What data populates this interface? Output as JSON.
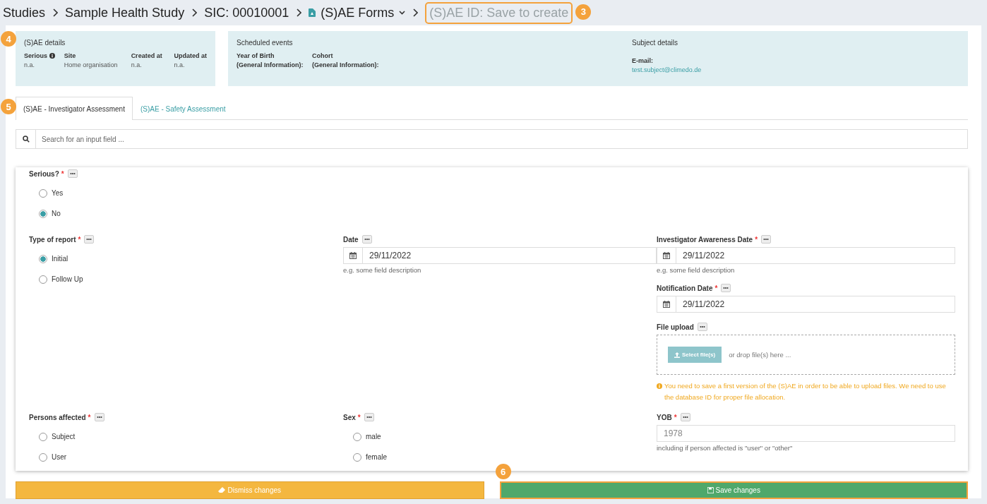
{
  "breadcrumb": [
    {
      "label": "Studies",
      "kind": "link"
    },
    {
      "label": "Sample Health Study",
      "kind": "link"
    },
    {
      "label": "SIC: 00010001",
      "kind": "link"
    },
    {
      "label": "(S)AE Forms",
      "kind": "menu"
    },
    {
      "label": "(S)AE ID: Save to create",
      "kind": "current",
      "badge": "3",
      "highlighted": true
    }
  ],
  "sae_details": {
    "title": "(S)AE details",
    "badge": "4",
    "fields": [
      {
        "label": "Serious",
        "value": "n.a.",
        "info": true
      },
      {
        "label": "Site",
        "value": "Home organisation",
        "info": false
      },
      {
        "label": "Created at",
        "value": "n.a.",
        "info": false
      },
      {
        "label": "Updated at",
        "value": "n.a.",
        "info": false
      }
    ]
  },
  "scheduled_events": {
    "title": "Scheduled events",
    "fields": [
      {
        "label": "Year of Birth",
        "sublabel": "(General Information):"
      },
      {
        "label": "Cohort",
        "sublabel": "(General Information):"
      }
    ]
  },
  "subject_details": {
    "title": "Subject details",
    "fields": [
      {
        "label": "E-mail:",
        "value": "test.subject@climedo.de"
      }
    ]
  },
  "tabs": [
    {
      "label": "(S)AE - Investigator Assessment",
      "selected": true,
      "badge": "5"
    },
    {
      "label": "(S)AE - Safety Assessment",
      "selected": false
    }
  ],
  "search": {
    "placeholder": "Search for an input field ..."
  },
  "form": {
    "required_mark": "*",
    "rows": [
      [
        [
          {
            "kind": "radio",
            "label": "Serious?",
            "required": true,
            "options": [
              {
                "label": "Yes",
                "selected": false
              },
              {
                "label": "No",
                "selected": true
              }
            ]
          }
        ]
      ],
      [
        [
          {
            "kind": "radio",
            "label": "Type of report",
            "required": true,
            "options": [
              {
                "label": "Initial",
                "selected": true
              },
              {
                "label": "Follow Up",
                "selected": false
              }
            ]
          }
        ],
        [
          {
            "kind": "date",
            "label": "Date",
            "required": false,
            "value": "29/11/2022",
            "description": "e.g. some field description"
          }
        ],
        [
          {
            "kind": "date",
            "label": "Investigator Awareness Date",
            "required": true,
            "value": "29/11/2022",
            "description": "e.g. some field description"
          },
          {
            "kind": "date",
            "label": "Notification Date",
            "required": true,
            "value": "29/11/2022"
          },
          {
            "kind": "file",
            "label": "File upload",
            "required": false,
            "button": "Select file(s)",
            "hint": "or drop file(s) here ...",
            "warning": "You need to save a first version of the (S)AE in order to be able to upload files. We need to use the database ID for proper file allocation."
          }
        ]
      ],
      [
        [
          {
            "kind": "radio",
            "label": "Persons affected",
            "required": true,
            "options": [
              {
                "label": "Subject",
                "selected": false
              },
              {
                "label": "User",
                "selected": false
              }
            ]
          }
        ],
        [
          {
            "kind": "radio",
            "label": "Sex",
            "required": true,
            "options": [
              {
                "label": "male",
                "selected": false
              },
              {
                "label": "female",
                "selected": false
              }
            ]
          }
        ],
        [
          {
            "kind": "number",
            "label": "YOB",
            "required": true,
            "placeholder": "1978",
            "description": "including if person affected is \"user\" or \"other\""
          }
        ]
      ]
    ]
  },
  "actions": [
    {
      "label": "Dismiss changes",
      "kind": "dismiss",
      "highlighted": false
    },
    {
      "label": "Save changes",
      "kind": "save",
      "badge": "6",
      "highlighted": true
    }
  ]
}
